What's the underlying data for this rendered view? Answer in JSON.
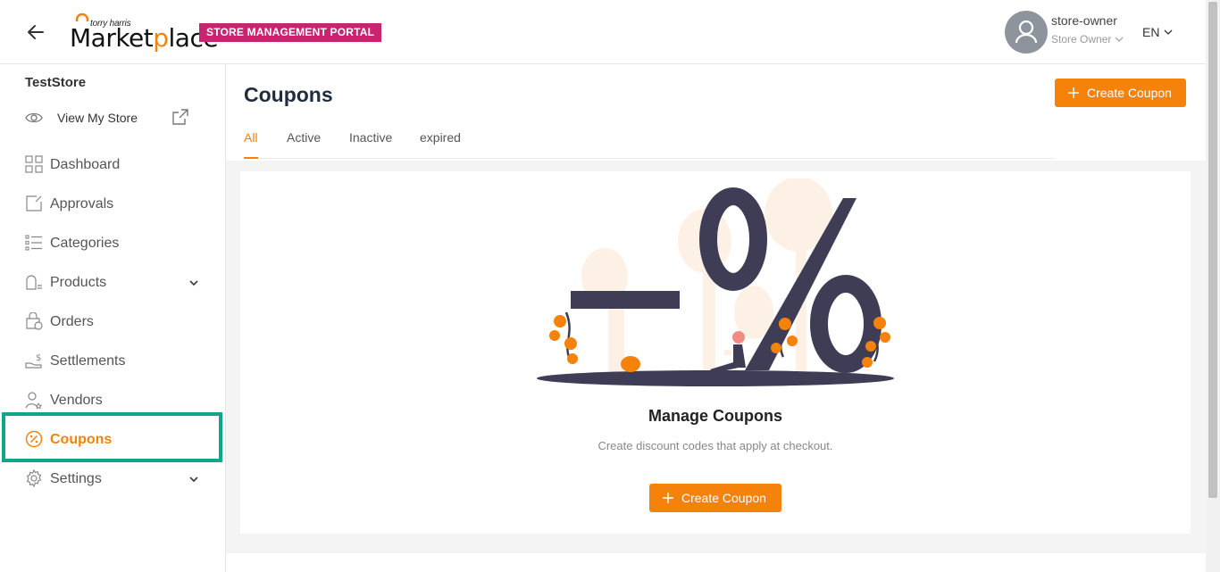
{
  "header": {
    "logo_small": "torry harris",
    "logo_big_pre": "Market",
    "logo_big_o": "p",
    "logo_big_post": "lace",
    "portal_badge": "STORE MANAGEMENT PORTAL",
    "user_name": "store-owner",
    "user_role": "Store Owner",
    "language": "EN"
  },
  "sidebar": {
    "store_name": "TestStore",
    "view_store_label": "View My Store",
    "items": [
      {
        "label": "Dashboard",
        "icon": "dashboard-icon"
      },
      {
        "label": "Approvals",
        "icon": "approvals-icon"
      },
      {
        "label": "Categories",
        "icon": "categories-icon"
      },
      {
        "label": "Products",
        "icon": "products-icon"
      },
      {
        "label": "Orders",
        "icon": "orders-icon"
      },
      {
        "label": "Settlements",
        "icon": "settlements-icon"
      },
      {
        "label": "Vendors",
        "icon": "vendors-icon"
      },
      {
        "label": "Coupons",
        "icon": "coupons-icon"
      },
      {
        "label": "Settings",
        "icon": "settings-icon"
      }
    ]
  },
  "main": {
    "title": "Coupons",
    "create_button": "Create Coupon",
    "tabs": [
      {
        "label": "All"
      },
      {
        "label": "Active"
      },
      {
        "label": "Inactive"
      },
      {
        "label": "expired"
      }
    ],
    "empty": {
      "title": "Manage Coupons",
      "subtitle": "Create discount codes that apply at checkout.",
      "button": "Create Coupon"
    }
  },
  "colors": {
    "accent": "#f5820b",
    "badge": "#c8246f",
    "highlight": "#0fa68a",
    "illustration_dark": "#3f3d56"
  }
}
